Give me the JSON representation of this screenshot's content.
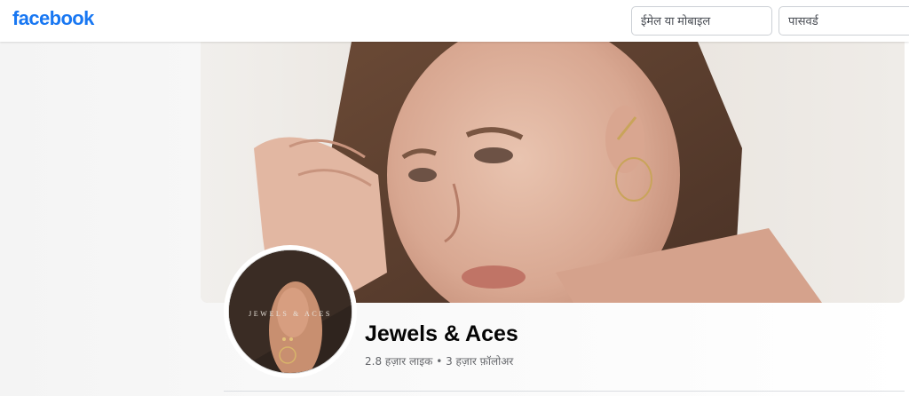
{
  "header": {
    "logo_text": "facebook",
    "brand_color": "#1877f2",
    "email_placeholder": "ईमेल या मोबाइल",
    "password_placeholder": "पासवर्ड"
  },
  "page": {
    "name": "Jewels & Aces",
    "likes": "2.8 हज़ार लाइक",
    "separator": "•",
    "followers": "3 हज़ार फ़ॉलोअर",
    "profile_brand_text": "JEWELS & ACES"
  }
}
